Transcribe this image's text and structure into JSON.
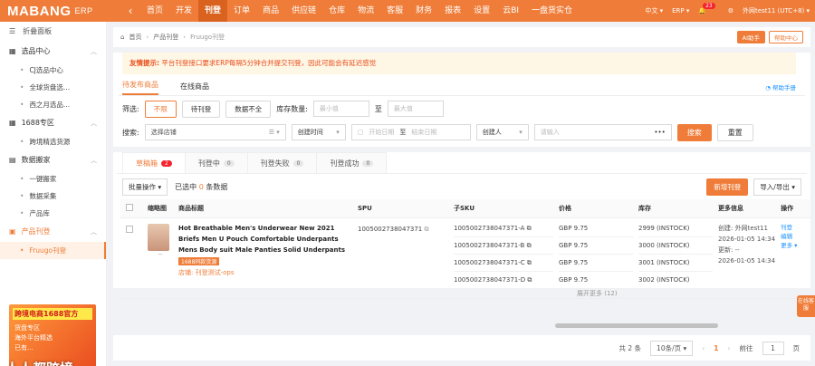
{
  "topbar": {
    "logo": "MABANG",
    "logo_suffix": "ERP",
    "nav": [
      "首页",
      "开发",
      "刊登",
      "订单",
      "商品",
      "供应链",
      "仓库",
      "物流",
      "客服",
      "财务",
      "报表",
      "设置",
      "云BI",
      "一盘货实仓"
    ],
    "nav_active": 2,
    "lang": "中文",
    "erp": "ERP",
    "notif": "23",
    "user": "外网test11 (UTC+8)"
  },
  "sidebar": {
    "fold": "折叠面板",
    "groups": [
      {
        "label": "选品中心",
        "items": [
          "CJ选品中心",
          "全球货盘选...",
          "西之月选品..."
        ]
      },
      {
        "label": "1688专区",
        "items": [
          "跨境精选货源"
        ]
      },
      {
        "label": "数据搬家",
        "items": [
          "一键搬家",
          "数据采集",
          "产品库"
        ]
      },
      {
        "label": "产品刊登",
        "items": [
          "Fruugo刊登"
        ]
      }
    ],
    "promo_title": "跨境电商1688官方",
    "promo_lines": [
      "货盘专区",
      "海外平台精选",
      "已有..."
    ],
    "watermark": "人人都跨境"
  },
  "crumb": {
    "home": "首页",
    "section": "产品刊登",
    "page": "Fruugo刊登",
    "ai_btn": "AI助手",
    "help_btn": "帮助中心"
  },
  "tip": {
    "label": "友情提示:",
    "text": "平台刊登接口要求ERP每隔5分钟合并提交刊登，因此可能会有延迟感觉"
  },
  "subtabs": {
    "items": [
      "待发布商品",
      "在线商品"
    ],
    "help": "帮助手册"
  },
  "filters": {
    "label_filter": "筛选:",
    "filter_buttons": [
      "不限",
      "待刊登",
      "数据不全"
    ],
    "stock_label": "库存数量:",
    "min_ph": "最小值",
    "to": "至",
    "max_ph": "最大值",
    "search_label": "搜索:",
    "store_ph": "选择店铺",
    "time_sel": "创建时间",
    "start_ph": "开始日期",
    "to2": "至",
    "end_ph": "结束日期",
    "creator_sel": "创建人",
    "input_ph": "请输入",
    "search_btn": "搜索",
    "reset_btn": "重置"
  },
  "status_tabs": [
    {
      "label": "草稿箱",
      "count": "2"
    },
    {
      "label": "刊登中",
      "count": "0"
    },
    {
      "label": "刊登失败",
      "count": "0"
    },
    {
      "label": "刊登成功",
      "count": "0"
    }
  ],
  "toolbar": {
    "bulk": "批量操作",
    "selected_pre": "已选中",
    "selected_n": "0",
    "selected_post": "条数据",
    "add_btn": "新增刊登",
    "io_btn": "导入/导出"
  },
  "table": {
    "headers": [
      "缩略图",
      "商品标题",
      "SPU",
      "子SKU",
      "价格",
      "库存",
      "更多信息",
      "操作"
    ],
    "row": {
      "title": "Hot Breathable Men's Underwear New 2021 Briefs Men U Pouch Comfortable Underpants Mens Body suit Male Panties Solid Underpants",
      "tag": "1688同款货源",
      "store": "店铺: 刊登测试-ops",
      "spu": "1005002738047371",
      "skus": [
        {
          "sku": "1005002738047371-A",
          "price": "GBP 9.75",
          "stock": "2999 (INSTOCK)"
        },
        {
          "sku": "1005002738047371-B",
          "price": "GBP 9.75",
          "stock": "3000 (INSTOCK)"
        },
        {
          "sku": "1005002738047371-C",
          "price": "GBP 9.75",
          "stock": "3001 (INSTOCK)"
        },
        {
          "sku": "1005002738047371-D",
          "price": "GBP 9.75",
          "stock": "3002 (INSTOCK)"
        }
      ],
      "more": [
        "创建: 外网test11",
        "2026-01-05 14:34",
        "更新: --",
        "2026-01-05 14:34"
      ],
      "ops": [
        "刊登",
        "编辑",
        "更多"
      ],
      "expand": "展开更多 (12)"
    }
  },
  "pager": {
    "total": "共 2 条",
    "size": "10条/页",
    "page": "1",
    "goto": "前往",
    "goto_val": "1",
    "unit": "页"
  },
  "sticky": "在线客服"
}
